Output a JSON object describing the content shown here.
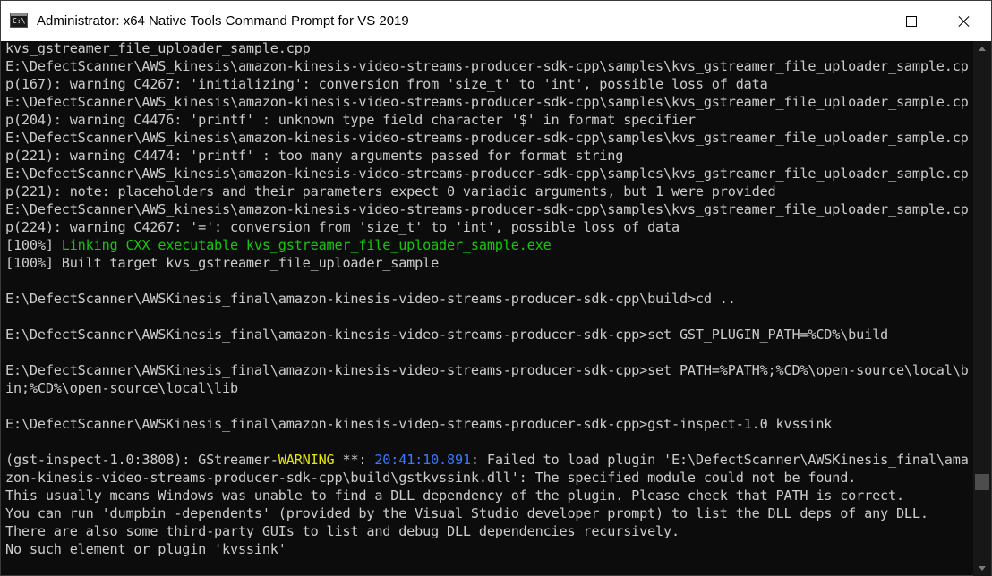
{
  "window": {
    "title": "Administrator: x64 Native Tools Command Prompt for VS 2019",
    "icon_text": "C:\\"
  },
  "console": {
    "lines": [
      {
        "segments": [
          {
            "text": "kvs_gstreamer_file_uploader_sample.cpp"
          }
        ]
      },
      {
        "segments": [
          {
            "text": "E:\\DefectScanner\\AWS_kinesis\\amazon-kinesis-video-streams-producer-sdk-cpp\\samples\\kvs_gstreamer_file_uploader_sample.cp"
          }
        ]
      },
      {
        "segments": [
          {
            "text": "p(167): warning C4267: 'initializing': conversion from 'size_t' to 'int', possible loss of data"
          }
        ]
      },
      {
        "segments": [
          {
            "text": "E:\\DefectScanner\\AWS_kinesis\\amazon-kinesis-video-streams-producer-sdk-cpp\\samples\\kvs_gstreamer_file_uploader_sample.cp"
          }
        ]
      },
      {
        "segments": [
          {
            "text": "p(204): warning C4476: 'printf' : unknown type field character '$' in format specifier"
          }
        ]
      },
      {
        "segments": [
          {
            "text": "E:\\DefectScanner\\AWS_kinesis\\amazon-kinesis-video-streams-producer-sdk-cpp\\samples\\kvs_gstreamer_file_uploader_sample.cp"
          }
        ]
      },
      {
        "segments": [
          {
            "text": "p(221): warning C4474: 'printf' : too many arguments passed for format string"
          }
        ]
      },
      {
        "segments": [
          {
            "text": "E:\\DefectScanner\\AWS_kinesis\\amazon-kinesis-video-streams-producer-sdk-cpp\\samples\\kvs_gstreamer_file_uploader_sample.cp"
          }
        ]
      },
      {
        "segments": [
          {
            "text": "p(221): note: placeholders and their parameters expect 0 variadic arguments, but 1 were provided"
          }
        ]
      },
      {
        "segments": [
          {
            "text": "E:\\DefectScanner\\AWS_kinesis\\amazon-kinesis-video-streams-producer-sdk-cpp\\samples\\kvs_gstreamer_file_uploader_sample.cp"
          }
        ]
      },
      {
        "segments": [
          {
            "text": "p(224): warning C4267: '=': conversion from 'size_t' to 'int', possible loss of data"
          }
        ]
      },
      {
        "segments": [
          {
            "text": "[100%] "
          },
          {
            "text": "Linking CXX executable kvs_gstreamer_file_uploader_sample.exe",
            "color": "green"
          }
        ]
      },
      {
        "segments": [
          {
            "text": "[100%] Built target kvs_gstreamer_file_uploader_sample"
          }
        ]
      },
      {
        "segments": [
          {
            "text": ""
          }
        ]
      },
      {
        "segments": [
          {
            "text": "E:\\DefectScanner\\AWSKinesis_final\\amazon-kinesis-video-streams-producer-sdk-cpp\\build>cd .."
          }
        ]
      },
      {
        "segments": [
          {
            "text": ""
          }
        ]
      },
      {
        "segments": [
          {
            "text": "E:\\DefectScanner\\AWSKinesis_final\\amazon-kinesis-video-streams-producer-sdk-cpp>set GST_PLUGIN_PATH=%CD%\\build"
          }
        ]
      },
      {
        "segments": [
          {
            "text": ""
          }
        ]
      },
      {
        "segments": [
          {
            "text": "E:\\DefectScanner\\AWSKinesis_final\\amazon-kinesis-video-streams-producer-sdk-cpp>set PATH=%PATH%;%CD%\\open-source\\local\\b"
          }
        ]
      },
      {
        "segments": [
          {
            "text": "in;%CD%\\open-source\\local\\lib"
          }
        ]
      },
      {
        "segments": [
          {
            "text": ""
          }
        ]
      },
      {
        "segments": [
          {
            "text": "E:\\DefectScanner\\AWSKinesis_final\\amazon-kinesis-video-streams-producer-sdk-cpp>gst-inspect-1.0 kvssink"
          }
        ]
      },
      {
        "segments": [
          {
            "text": ""
          }
        ]
      },
      {
        "segments": [
          {
            "text": "(gst-inspect-1.0:3808): GStreamer-"
          },
          {
            "text": "WARNING",
            "color": "yellow"
          },
          {
            "text": " **: "
          },
          {
            "text": "20:41:10.891",
            "color": "blue"
          },
          {
            "text": ": Failed to load plugin 'E:\\DefectScanner\\AWSKinesis_final\\ama"
          }
        ]
      },
      {
        "segments": [
          {
            "text": "zon-kinesis-video-streams-producer-sdk-cpp\\build\\gstkvssink.dll': The specified module could not be found."
          }
        ]
      },
      {
        "segments": [
          {
            "text": "This usually means Windows was unable to find a DLL dependency of the plugin. Please check that PATH is correct."
          }
        ]
      },
      {
        "segments": [
          {
            "text": "You can run 'dumpbin -dependents' (provided by the Visual Studio developer prompt) to list the DLL deps of any DLL."
          }
        ]
      },
      {
        "segments": [
          {
            "text": "There are also some third-party GUIs to list and debug DLL dependencies recursively."
          }
        ]
      },
      {
        "segments": [
          {
            "text": "No such element or plugin 'kvssink'"
          }
        ]
      }
    ]
  },
  "colors": {
    "background": "#0c0c0c",
    "text": "#cccccc",
    "green": "#16c60c",
    "yellow": "#e5e510",
    "blue": "#3b78ff"
  },
  "icons": {
    "minimize": "minimize-icon",
    "maximize": "maximize-icon",
    "close": "close-icon"
  }
}
